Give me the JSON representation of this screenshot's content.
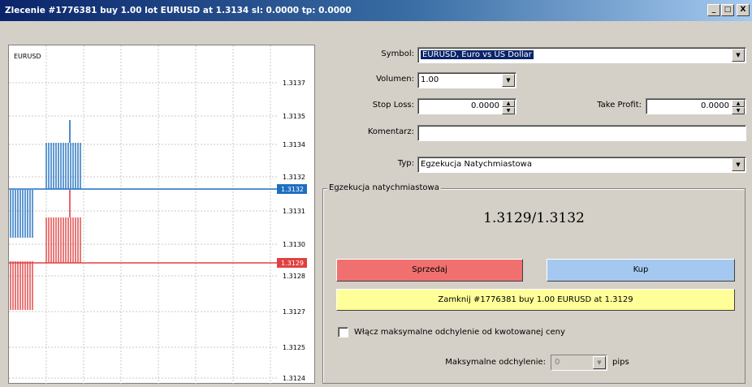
{
  "window": {
    "title": "Zlecenie #1776381 buy 1.00 lot EURUSD at 1.3134 sl: 0.0000 tp: 0.0000",
    "minimize_glyph": "_",
    "maximize_glyph": "□",
    "close_glyph": "X"
  },
  "chart": {
    "symbol": "EURUSD",
    "price_labels": [
      "1.3137",
      "1.3135",
      "1.3134",
      "1.3132",
      "1.3131",
      "1.3130",
      "1.3128",
      "1.3127",
      "1.3125",
      "1.3124"
    ],
    "ask_marker": "1.3132",
    "bid_marker": "1.3129",
    "ask_color": "#1f6fc0",
    "bid_color": "#e04040"
  },
  "form": {
    "symbol_label": "Symbol:",
    "symbol_value": "EURUSD, Euro vs US Dollar",
    "volume_label": "Volumen:",
    "volume_value": "1.00",
    "stop_loss_label": "Stop Loss:",
    "stop_loss_value": "0.0000",
    "take_profit_label": "Take Profit:",
    "take_profit_value": "0.0000",
    "comment_label": "Komentarz:",
    "comment_value": "",
    "type_label": "Typ:",
    "type_value": "Egzekucja Natychmiastowa"
  },
  "execution": {
    "group_title": "Egzekucja natychmiastowa",
    "quote": "1.3129/1.3132",
    "sell_label": "Sprzedaj",
    "buy_label": "Kup",
    "close_label": "Zamknij #1776381 buy 1.00 EURUSD at 1.3129",
    "deviation_checkbox_label": "Włącz maksymalne odchylenie od kwotowanej ceny",
    "deviation_label": "Maksymalne odchylenie:",
    "deviation_value": "0",
    "deviation_unit": "pips",
    "sell_color": "#f07070",
    "buy_color": "#a4c8f0",
    "close_color": "#ffff99"
  }
}
